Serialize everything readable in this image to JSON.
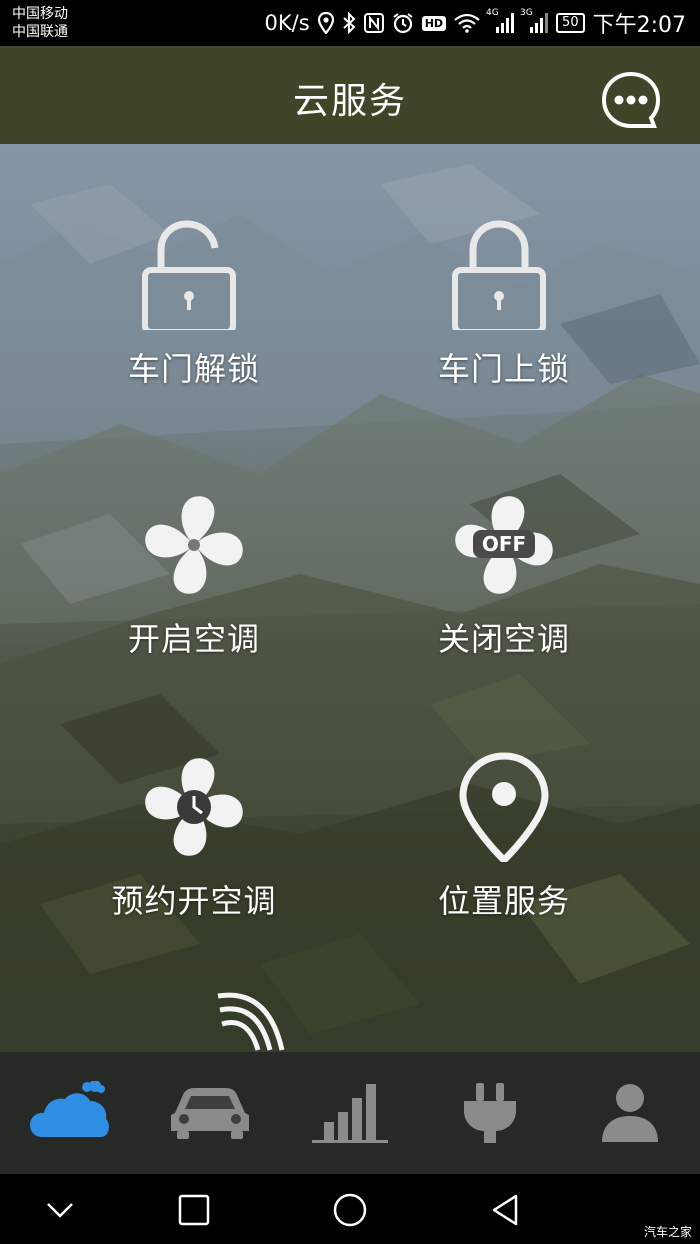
{
  "status_bar": {
    "carrier_1": "中国移动",
    "carrier_2": "中国联通",
    "net_speed": "0K/s",
    "network_1": "4G",
    "network_2": "3G",
    "hd_label": "HD",
    "battery": "50",
    "time": "下午2:07"
  },
  "header": {
    "title": "云服务",
    "menu_icon": "chat-bubble-more-icon"
  },
  "tiles": [
    {
      "label": "车门解锁",
      "icon": "unlock-icon"
    },
    {
      "label": "车门上锁",
      "icon": "lock-icon"
    },
    {
      "label": "开启空调",
      "icon": "fan-icon"
    },
    {
      "label": "关闭空调",
      "icon": "fan-off-icon",
      "badge": "OFF"
    },
    {
      "label": "预约开空调",
      "icon": "fan-clock-icon"
    },
    {
      "label": "位置服务",
      "icon": "location-pin-icon"
    }
  ],
  "bottom_nav": [
    {
      "icon": "cloud-icon",
      "active": true,
      "active_color": "#2f8de4"
    },
    {
      "icon": "car-icon",
      "active": false
    },
    {
      "icon": "bar-chart-icon",
      "active": false
    },
    {
      "icon": "plug-icon",
      "active": false
    },
    {
      "icon": "user-icon",
      "active": false
    }
  ],
  "system_nav": {
    "watermark": "汽车之家"
  }
}
